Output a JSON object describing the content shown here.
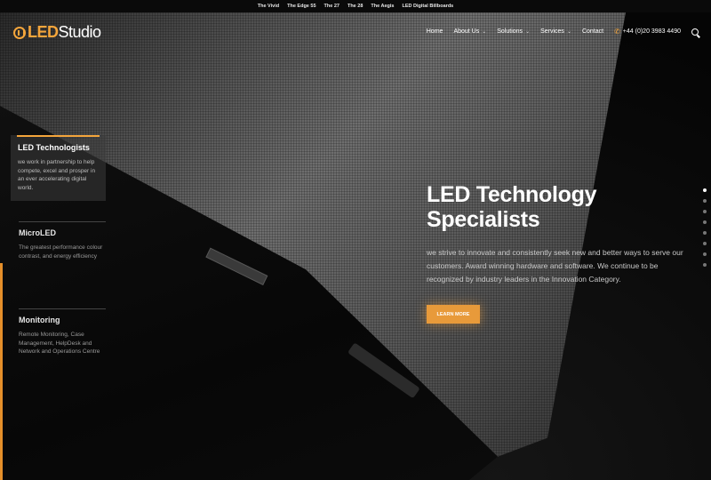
{
  "topbar": {
    "links": [
      "The Vivid",
      "The Edge 55",
      "The 27",
      "The 28",
      "The Aegis",
      "LED Digital Billboards"
    ]
  },
  "logo": {
    "led": "LED",
    "studio": "Studio",
    "icon": "light-bulb-icon"
  },
  "nav": {
    "home": "Home",
    "about": "About Us",
    "solutions": "Solutions",
    "services": "Services",
    "contact": "Contact",
    "phone": "+44 (0)20 3983 4490",
    "phone_icon": "phone-icon",
    "search_icon": "search-icon"
  },
  "sidebar": {
    "items": [
      {
        "title": "LED Technologists",
        "desc": "we work in partnership to help compete, excel and prosper in an ever accelerating digital world."
      },
      {
        "title": "MicroLED",
        "desc": "The greatest performance colour contrast, and energy efficiency"
      },
      {
        "title": "Monitoring",
        "desc": "Remote Monitoring, Case Management, HelpDesk and Network and Operations Centre"
      }
    ]
  },
  "hero": {
    "title_line1": "LED Technology",
    "title_line2": "Specialists",
    "description": "we strive to innovate and consistently seek new and better ways to serve our customers. Award winning hardware and software. We continue to be recognized by industry leaders in the Innovation Category.",
    "cta": "LEARN MORE"
  },
  "slider": {
    "count": 8,
    "active_index": 0
  },
  "colors": {
    "accent": "#f4a53b",
    "button": "#e89a3a",
    "background": "#0b0b0b"
  }
}
